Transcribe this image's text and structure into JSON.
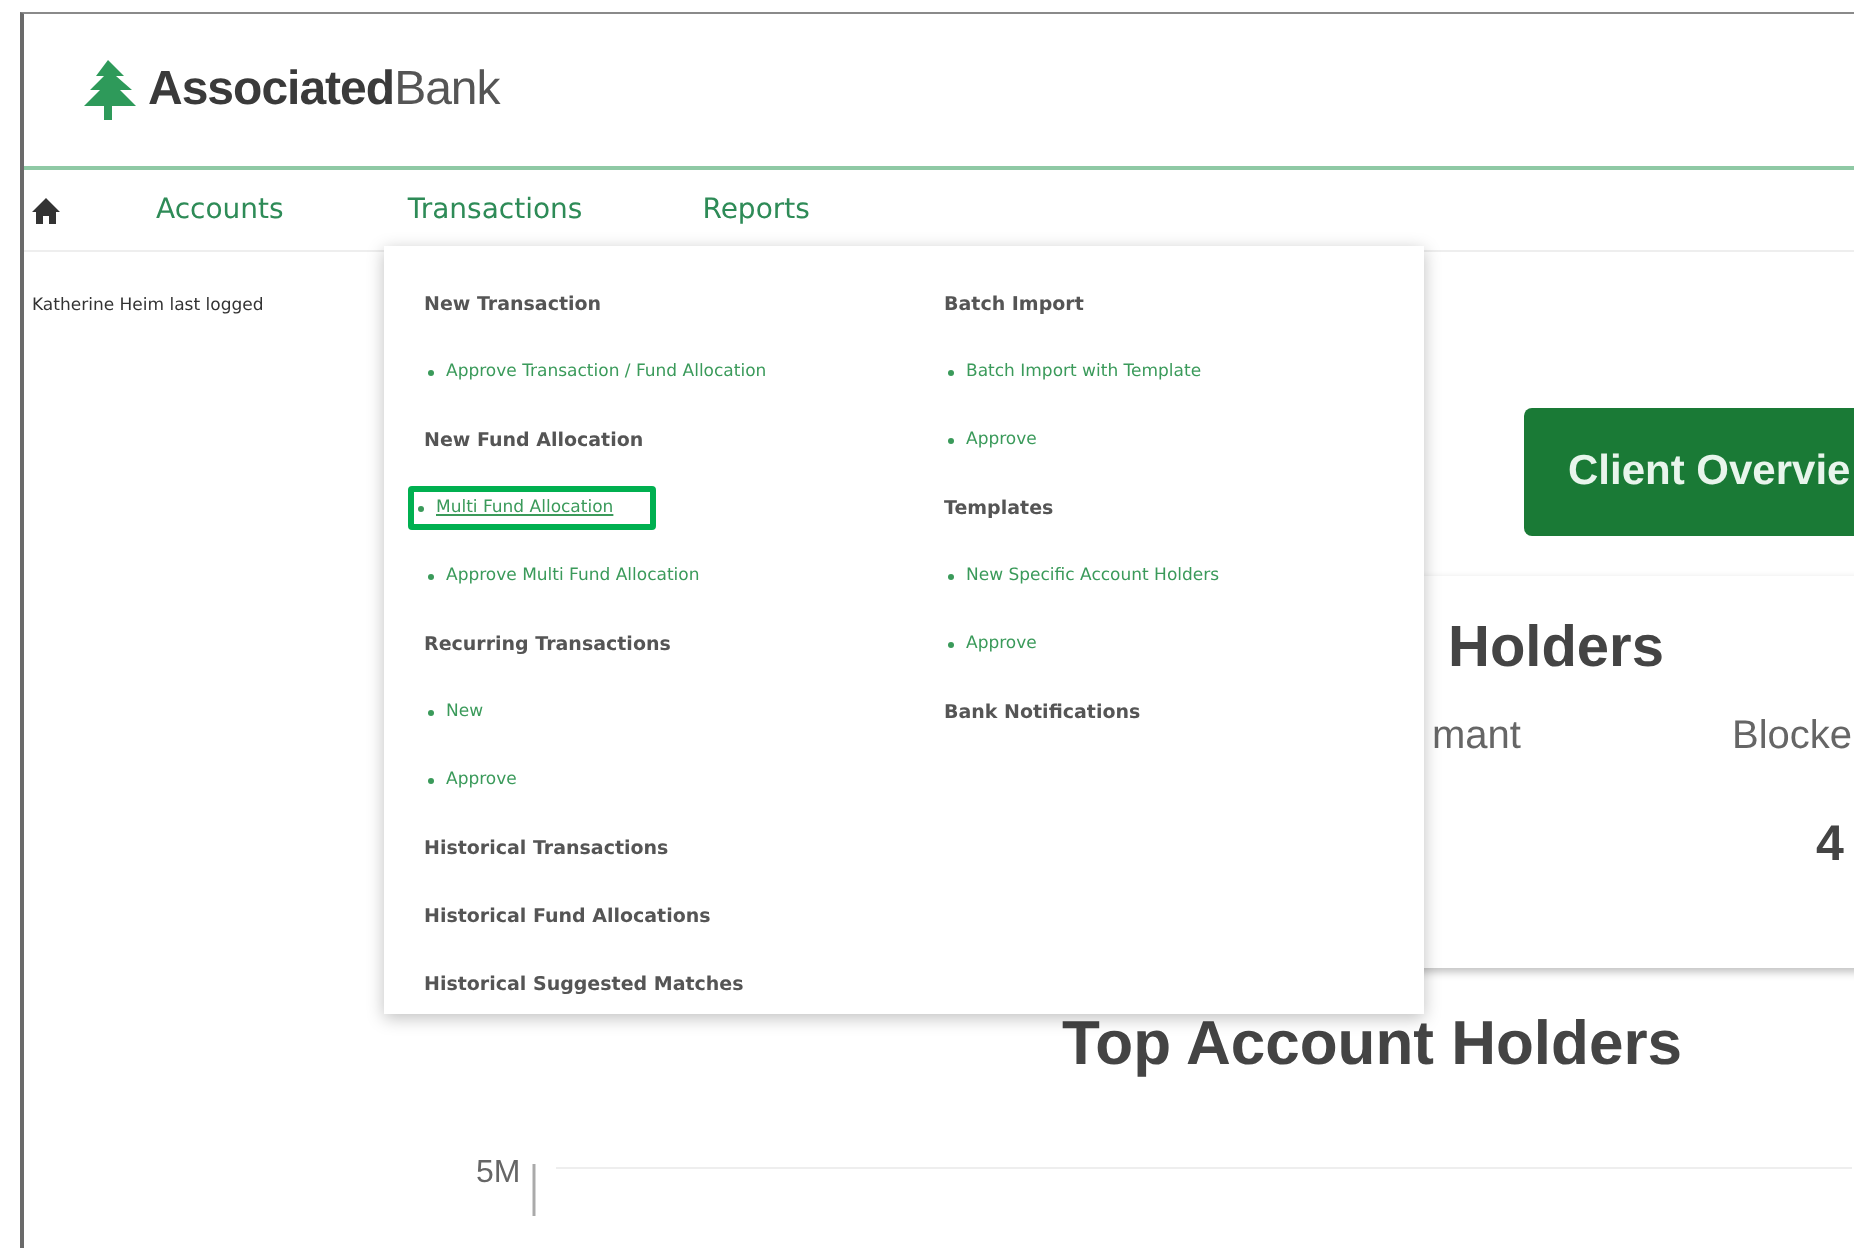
{
  "header": {
    "logo": {
      "bold": "Associated",
      "light": "Bank"
    }
  },
  "nav": {
    "items": [
      "Accounts",
      "Transactions",
      "Reports"
    ]
  },
  "sidebar": {
    "text": "Katherine Heim last logged"
  },
  "main": {
    "button": "Client Overvie",
    "card": {
      "title": "Holders",
      "stats": [
        {
          "label": "mant"
        },
        {
          "label": "Blocke",
          "value": "4"
        }
      ]
    },
    "chart_title": "Top Account Holders",
    "axis_tick": "5M"
  },
  "menu": {
    "columns": [
      {
        "sections": [
          {
            "title": "New Transaction",
            "items": [
              {
                "label": "Approve Transaction / Fund Allocation",
                "highlighted": false
              }
            ]
          },
          {
            "title": "New Fund Allocation",
            "items": [
              {
                "label": "Multi Fund Allocation",
                "highlighted": true
              },
              {
                "label": "Approve Multi Fund Allocation",
                "highlighted": false
              }
            ]
          },
          {
            "title": "Recurring Transactions",
            "items": [
              {
                "label": "New",
                "highlighted": false
              },
              {
                "label": "Approve",
                "highlighted": false
              }
            ]
          },
          {
            "title": "Historical Transactions"
          },
          {
            "title": "Historical Fund Allocations"
          },
          {
            "title": "Historical Suggested Matches"
          }
        ]
      },
      {
        "sections": [
          {
            "title": "Batch Import",
            "items": [
              {
                "label": "Batch Import with Template",
                "highlighted": false
              },
              {
                "label": "Approve",
                "highlighted": false
              }
            ]
          },
          {
            "title": "Templates",
            "items": [
              {
                "label": "New Specific Account Holders",
                "highlighted": false
              },
              {
                "label": "Approve",
                "highlighted": false
              }
            ]
          },
          {
            "title": "Bank Notifications"
          }
        ]
      }
    ]
  }
}
